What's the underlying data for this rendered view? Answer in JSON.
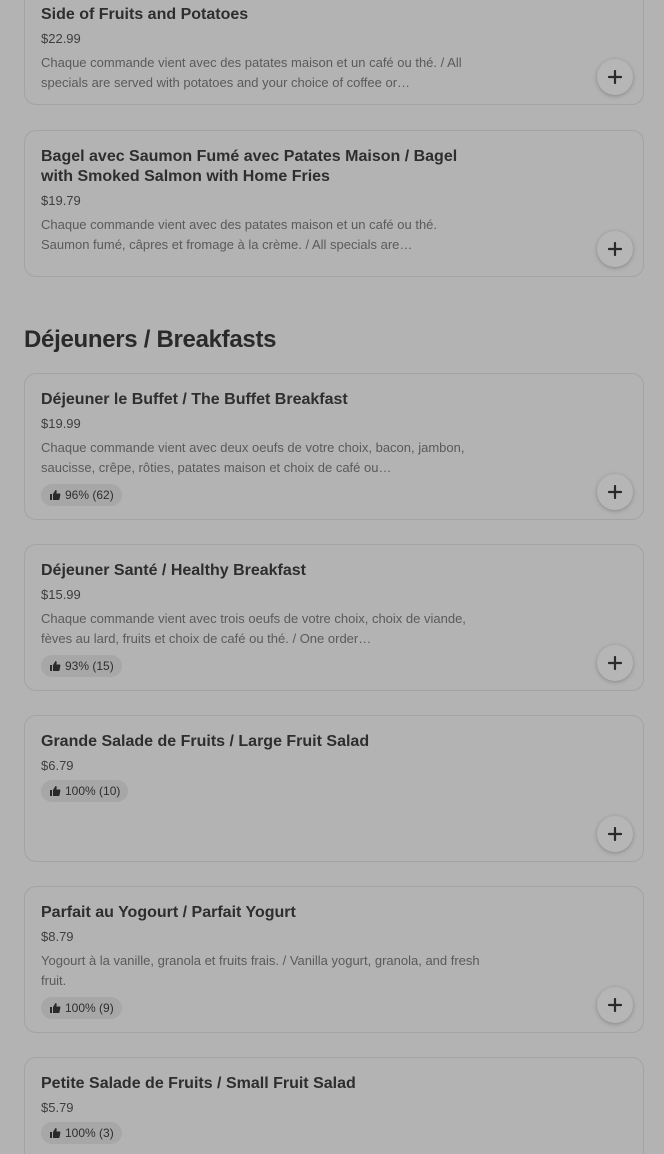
{
  "top_items": [
    {
      "title": "Side of Fruits and Potatoes",
      "price": "$22.99",
      "description": "Chaque commande vient avec des patates maison et un café ou thé. / All specials are served with potatoes and your choice of coffee or…"
    },
    {
      "title": "Bagel avec Saumon Fumé avec Patates Maison / Bagel with Smoked Salmon with Home Fries",
      "price": "$19.79",
      "description": "Chaque commande vient avec des patates maison et un café ou thé. Saumon fumé, câpres et fromage à la crème. / All specials are…"
    }
  ],
  "section": {
    "title": "Déjeuners / Breakfasts"
  },
  "items": [
    {
      "title": "Déjeuner le Buffet / The Buffet Breakfast",
      "price": "$19.99",
      "description": "Chaque commande vient avec deux oeufs de votre choix, bacon, jambon, saucisse, crêpe, rôties, patates maison et choix de café ou…",
      "rating": "96% (62)"
    },
    {
      "title": "Déjeuner Santé / Healthy Breakfast",
      "price": "$15.99",
      "description": "Chaque commande vient avec trois oeufs de votre choix, choix de viande, fèves au lard, fruits et choix de café ou thé. / One order…",
      "rating": "93% (15)"
    },
    {
      "title": "Grande Salade de Fruits / Large Fruit Salad",
      "price": "$6.79",
      "rating": "100% (10)"
    },
    {
      "title": "Parfait au Yogourt / Parfait Yogurt",
      "price": "$8.79",
      "description": "Yogourt à la vanille, granola et fruits frais. / Vanilla yogurt, granola, and fresh fruit.",
      "rating": "100% (9)"
    },
    {
      "title": "Petite Salade de Fruits / Small Fruit Salad",
      "price": "$5.79",
      "rating": "100% (3)"
    }
  ],
  "icons": {
    "add": "plus-icon",
    "rating": "thumbs-up-icon"
  }
}
